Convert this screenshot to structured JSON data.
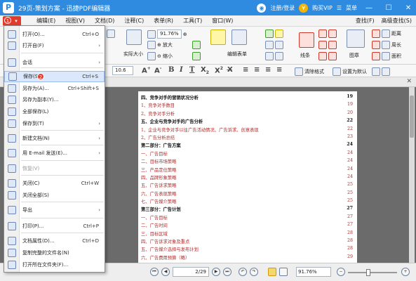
{
  "window": {
    "title": "29页-策划方案 - 迅捷PDF编辑器",
    "login": "注册/登录",
    "vip": "购买VIP",
    "menu_label": "菜单"
  },
  "menubar": {
    "file_badge": "1",
    "items": [
      "编辑(E)",
      "视图(V)",
      "文档(D)",
      "注释(C)",
      "表单(R)",
      "工具(T)",
      "窗口(W)"
    ],
    "right": [
      "查找(F)",
      "高级查找(S)"
    ]
  },
  "ribbon": {
    "zoom_value": "91.76%",
    "actual_size": "实际大小",
    "zoom_in": "放大",
    "zoom_out": "缩小",
    "edit_form": "编辑表单",
    "line": "线条",
    "figure": "图章",
    "distance": "距离",
    "perimeter": "周长",
    "area": "面积"
  },
  "formatbar": {
    "font_size": "10.6",
    "clear_format": "清除格式",
    "set_default": "设置为默认"
  },
  "dropdown": {
    "items": [
      {
        "label": "打开(O)...",
        "shortcut": "Ctrl+O",
        "arrow": "",
        "icon": "folder-open-icon"
      },
      {
        "label": "打开自(F)",
        "shortcut": "",
        "arrow": "›",
        "icon": "folder-icon"
      },
      {
        "label": "会话",
        "shortcut": "",
        "arrow": "›",
        "icon": "session-icon"
      },
      {
        "label": "保存(S)",
        "shortcut": "Ctrl+S",
        "arrow": "",
        "icon": "save-icon",
        "badge": "2"
      },
      {
        "label": "另存为(A)...",
        "shortcut": "Ctrl+Shift+S",
        "arrow": "",
        "icon": "save-as-icon"
      },
      {
        "label": "另存为副本(Y)...",
        "shortcut": "",
        "arrow": "",
        "icon": "save-copy-icon"
      },
      {
        "label": "全部保存(L)",
        "shortcut": "",
        "arrow": "",
        "icon": "save-all-icon"
      },
      {
        "label": "保存到(T)",
        "shortcut": "",
        "arrow": "›",
        "icon": "save-to-icon"
      },
      {
        "label": "新建文档(N)",
        "shortcut": "",
        "arrow": "›",
        "icon": "new-document-icon"
      },
      {
        "label": "用 E-mail 发送(E)...",
        "shortcut": "",
        "arrow": "›",
        "icon": "email-icon"
      },
      {
        "label": "恢复(V)",
        "shortcut": "",
        "arrow": "",
        "icon": "revert-icon",
        "disabled": true
      },
      {
        "label": "关闭(C)",
        "shortcut": "Ctrl+W",
        "arrow": "",
        "icon": "close-document-icon"
      },
      {
        "label": "关闭全部(S)",
        "shortcut": "",
        "arrow": "",
        "icon": "close-all-icon"
      },
      {
        "label": "导出",
        "shortcut": "",
        "arrow": "›",
        "icon": "export-icon"
      },
      {
        "label": "打印(P)...",
        "shortcut": "Ctrl+P",
        "arrow": "",
        "icon": "print-icon"
      },
      {
        "label": "文档属性(D)...",
        "shortcut": "Ctrl+D",
        "arrow": "",
        "icon": "properties-icon"
      },
      {
        "label": "复制完整的文件名(N)",
        "shortcut": "",
        "arrow": "",
        "icon": "copy-filename-icon"
      },
      {
        "label": "打开所在文件夹(F)...",
        "shortcut": "",
        "arrow": "",
        "icon": "open-folder-icon"
      }
    ]
  },
  "toc": [
    {
      "text": "四、竞争对手的营销状况分析",
      "page": "19",
      "bold": true
    },
    {
      "text": "1、竞争对手数目",
      "page": "19",
      "bold": false
    },
    {
      "text": "2、竞争对手分析",
      "page": "20",
      "bold": false
    },
    {
      "text": "五、企业与竞争对手的广告分析",
      "page": "22",
      "bold": true
    },
    {
      "text": "1、企业与竞争对手以往广告活动情况、广告诉求、创意表现",
      "page": "22",
      "bold": false
    },
    {
      "text": "2、广告分析总结",
      "page": "23",
      "bold": false
    },
    {
      "text": "第二部分：广告方案",
      "page": "24",
      "bold": true
    },
    {
      "text": "一、广告目标",
      "page": "24",
      "bold": false
    },
    {
      "text": "二、目标市场策略",
      "page": "24",
      "bold": false
    },
    {
      "text": "三、产品定位策略",
      "page": "24",
      "bold": false
    },
    {
      "text": "四、品牌形象策略",
      "page": "24",
      "bold": false
    },
    {
      "text": "五、广告诉求策略",
      "page": "25",
      "bold": false
    },
    {
      "text": "六、广告表现策略",
      "page": "25",
      "bold": false
    },
    {
      "text": "七、广告媒介策略",
      "page": "25",
      "bold": false
    },
    {
      "text": "第三部分：广告计划",
      "page": "27",
      "bold": true
    },
    {
      "text": "一、广告目标",
      "page": "27",
      "bold": false
    },
    {
      "text": "二、广告时间",
      "page": "27",
      "bold": false
    },
    {
      "text": "三、目标区域",
      "page": "28",
      "bold": false
    },
    {
      "text": "四、广告诉求对象及重点",
      "page": "28",
      "bold": false
    },
    {
      "text": "五、广告媒介选择与发布计划",
      "page": "28",
      "bold": false
    },
    {
      "text": "六、广告费用预算（略）",
      "page": "29",
      "bold": false
    }
  ],
  "status": {
    "page": "2/29",
    "zoom": "91.76%"
  }
}
